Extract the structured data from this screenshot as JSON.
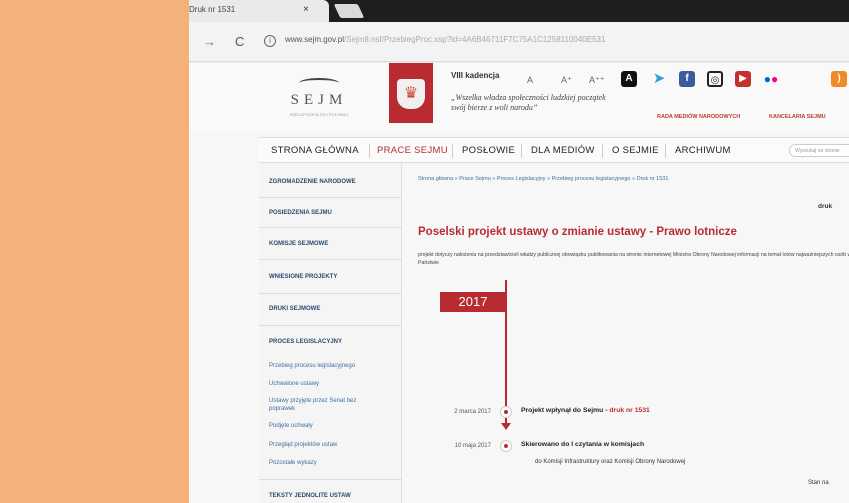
{
  "browser": {
    "tab_title": "Druk nr 1531",
    "tab_close": "×",
    "url_main": "www.sejm.gov.pl",
    "url_rest": "/Sejm8.nsf/PrzebiegProc.xsp?id=4A6B46711F7C75A1C1258110040E531"
  },
  "header": {
    "logo_word": "SEJM",
    "logo_sub": "RZECZPOSPOLITEJ POLSKIEJ",
    "kadencja": "VIII kadencja",
    "motto": "„Wszelka władza społeczności ludzkiej początek swój bierze z woli narodu”",
    "font_small": "A",
    "font_medium": "A⁺",
    "font_large": "A⁺⁺",
    "link_rada": "RADA MEDIÓW NARODOWYCH",
    "link_kancelaria": "KANCELARIA SEJMU",
    "social_icons": [
      "contrast-icon",
      "twitter-icon",
      "facebook-icon",
      "instagram-icon",
      "youtube-icon",
      "flickr-icon",
      "rss-icon"
    ]
  },
  "nav": {
    "items": [
      "STRONA GŁÓWNA",
      "PRACE SEJMU",
      "POSŁOWIE",
      "DLA MEDIÓW",
      "O SEJMIE",
      "ARCHIWUM"
    ],
    "search_placeholder": "Wyszukaj na stronie"
  },
  "sidebar": {
    "sections": [
      "ZGROMADZENIE NARODOWE",
      "POSIEDZENIA SEJMU",
      "KOMISJE SEJMOWE",
      "WNIESIONE PROJEKTY",
      "DRUKI SEJMOWE",
      "PROCES LEGISLACYJNY"
    ],
    "subitems": [
      "Przebieg procesu legislacyjnego",
      "Uchwalone ustawy",
      "Ustawy przyjęte przez Senat bez poprawek",
      "Podjęte uchwały",
      "Przegląd projektów ustaw",
      "Pozostałe wykazy"
    ],
    "bottom_section": "TEKSTY JEDNOLITE USTAW"
  },
  "main": {
    "breadcrumb": "Strona główna » Prace Sejmu » Proces Legislacyjny » Przebieg procesu legislacyjnego » Druk nr 1531",
    "druk_right": "druk",
    "title": "Poselski projekt ustawy o zmianie ustawy - Prawo lotnicze",
    "description": "projekt dotyczy nałożenia na przedstawicieli władzy publicznej obowiązku publikowania na stronie internetowej Ministra Obrony Narodowej informacji na temat lotów najważniejszych osób w Państwie",
    "year": "2017",
    "events": [
      {
        "date": "2 marca 2017",
        "title": "Projekt wpłynął do Sejmu - ",
        "link": "druk nr 1531"
      },
      {
        "date": "10 maja 2017",
        "title": "Skierowano do I czytania w komisjach",
        "link": ""
      }
    ],
    "event2_sub": "do Komisji Infrastruktury oraz Komisji Obrony Narodowej",
    "stan": "Stan na"
  },
  "colors": {
    "accent": "#b82c31",
    "link": "#3d6fa3",
    "sidebar_heading": "#2c4a6e"
  }
}
